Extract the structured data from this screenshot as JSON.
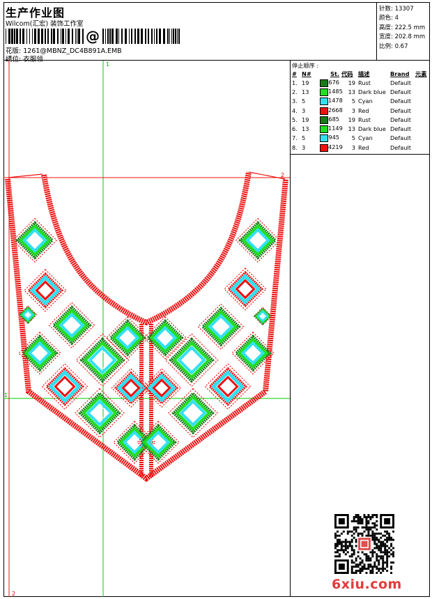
{
  "header": {
    "title": "生产作业图",
    "company": "Wilcom(汇宏) 装饰工作室",
    "barcode_char": "@",
    "pattern_label": "花版:",
    "pattern_value": "1261@MBNZ_DC4B891A.EMB",
    "position_label": "绣位:",
    "position_value": "衣服领"
  },
  "stats": {
    "stitches": "针数: 13307",
    "colors": "颜色: 4",
    "height": "高度: 222.5 mm",
    "width": "宽度: 202.8 mm",
    "scale": "比例: 0.67"
  },
  "color_panel": {
    "heading": "停止顺序 :",
    "columns": [
      "#",
      "N#",
      "St.",
      "代码",
      "描述",
      "Brand",
      "元素"
    ],
    "rows": [
      {
        "idx": "1.",
        "n": "19",
        "swatch": "#1a7a1a",
        "st": "676",
        "code": "19",
        "desc": "Rust",
        "brand": "Default"
      },
      {
        "idx": "2.",
        "n": "13",
        "swatch": "#22dd22",
        "st": "1485",
        "code": "13",
        "desc": "Dark blue",
        "brand": "Default"
      },
      {
        "idx": "3.",
        "n": "5",
        "swatch": "#33e0f0",
        "st": "1478",
        "code": "5",
        "desc": "Cyan",
        "brand": "Default"
      },
      {
        "idx": "4.",
        "n": "3",
        "swatch": "#ee1111",
        "st": "2668",
        "code": "3",
        "desc": "Red",
        "brand": "Default"
      },
      {
        "idx": "5.",
        "n": "19",
        "swatch": "#1a7a1a",
        "st": "685",
        "code": "19",
        "desc": "Rust",
        "brand": "Default"
      },
      {
        "idx": "6.",
        "n": "13",
        "swatch": "#22dd22",
        "st": "1149",
        "code": "13",
        "desc": "Dark blue",
        "brand": "Default"
      },
      {
        "idx": "7.",
        "n": "5",
        "swatch": "#33e0f0",
        "st": "945",
        "code": "5",
        "desc": "Cyan",
        "brand": "Default"
      },
      {
        "idx": "8.",
        "n": "3",
        "swatch": "#ee1111",
        "st": "4219",
        "code": "3",
        "desc": "Red",
        "brand": "Default"
      }
    ]
  },
  "guides": {
    "label_top": "1",
    "label_left": "1",
    "label_right": "2",
    "label_bottom": "2"
  },
  "colors": {
    "red": "#ee1111",
    "green": "#22dd22",
    "dark_green": "#1a7a1a",
    "cyan": "#33e0f0",
    "guide_green": "#00cc00"
  },
  "watermark": "6xiu.com"
}
